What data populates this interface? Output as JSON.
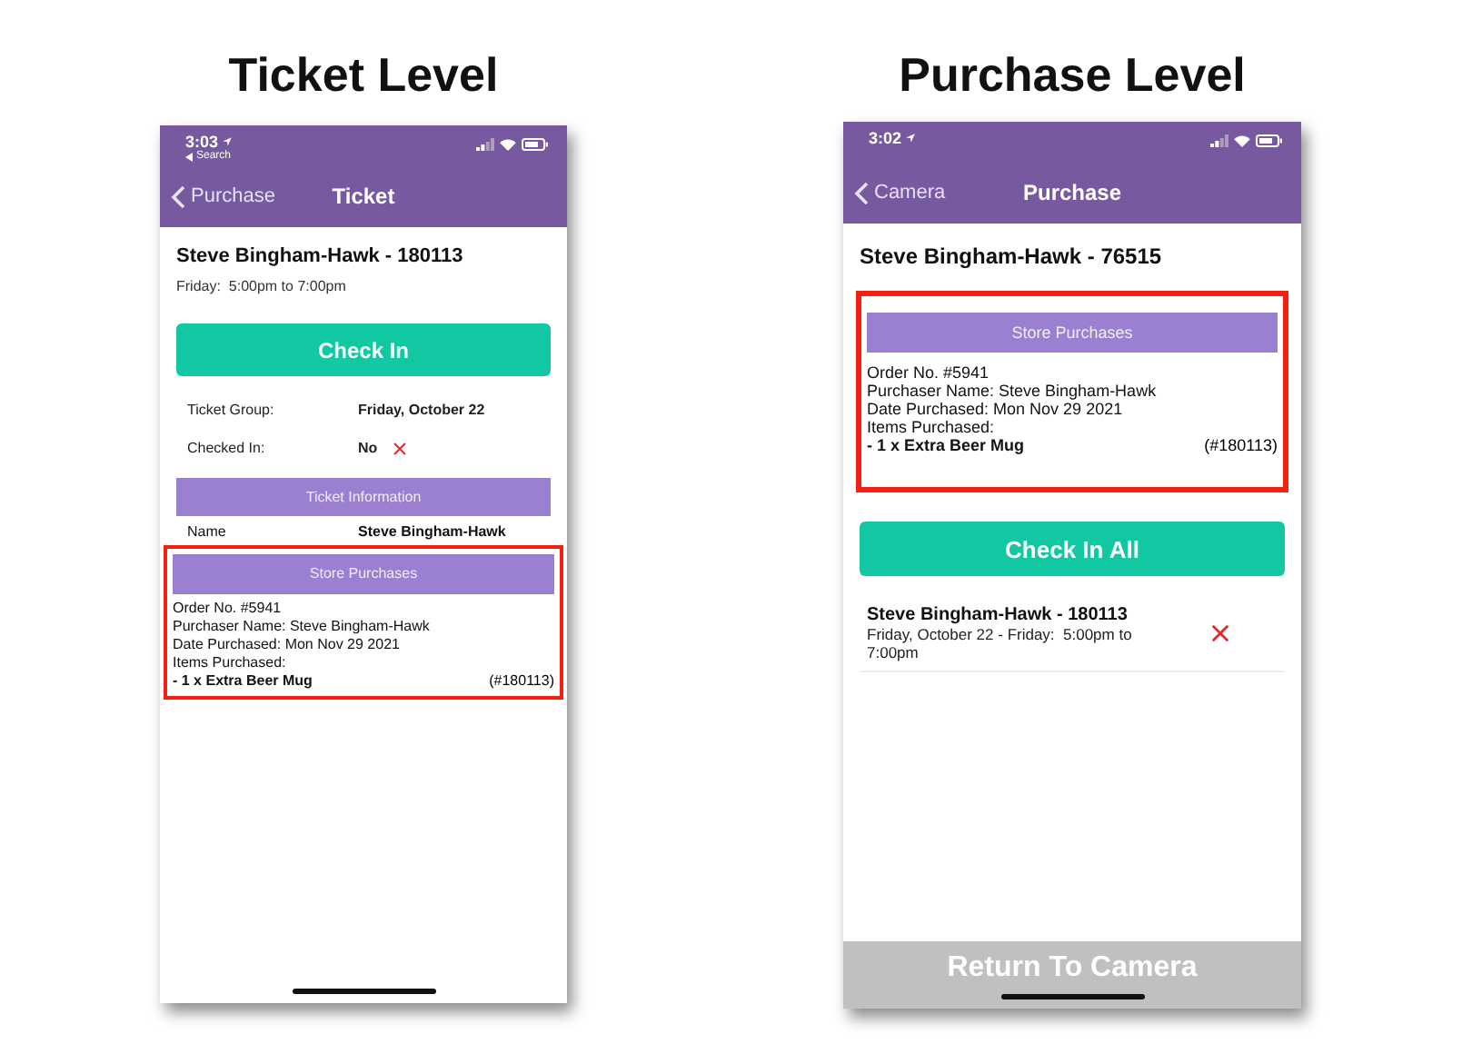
{
  "ticket_level": {
    "title": "Ticket Level",
    "status_bar": {
      "time": "3:03",
      "back_app": "Search"
    },
    "nav": {
      "back": "Purchase",
      "title": "Ticket"
    },
    "heading": "Steve Bingham-Hawk - 180113",
    "subheading": "Friday:  5:00pm to 7:00pm",
    "button": "Check In",
    "details": [
      {
        "label": "Ticket Group:",
        "value": "Friday, October 22"
      },
      {
        "label": "Checked In:",
        "value": "No",
        "checked_in": false
      }
    ],
    "info_header": "Ticket Information",
    "info_rows": [
      {
        "label": "Name",
        "value": "Steve Bingham-Hawk"
      }
    ],
    "purchases": {
      "header": "Store Purchases",
      "highlighted": true,
      "lines": [
        "Order No. #5941",
        "Purchaser Name: Steve Bingham-Hawk",
        "Date Purchased: Mon Nov 29 2021",
        "Items Purchased:"
      ],
      "item": {
        "text": "- 1 x Extra Beer Mug",
        "ref": "(#180113)"
      }
    }
  },
  "purchase_level": {
    "title": "Purchase Level",
    "status_bar": {
      "time": "3:02"
    },
    "nav": {
      "back": "Camera",
      "title": "Purchase"
    },
    "heading": "Steve Bingham-Hawk - 76515",
    "purchases": {
      "header": "Store Purchases",
      "highlighted": true,
      "lines": [
        "Order No. #5941",
        "Purchaser Name: Steve Bingham-Hawk",
        "Date Purchased: Mon Nov 29 2021",
        "Items Purchased:"
      ],
      "item": {
        "text": "- 1 x Extra Beer Mug",
        "ref": "(#180113)"
      }
    },
    "button": "Check In All",
    "tickets": [
      {
        "title": "Steve Bingham-Hawk - 180113",
        "subtitle": "Friday, October 22 - Friday:  5:00pm to 7:00pm",
        "checked_in": false
      }
    ],
    "footer_button": "Return To Camera"
  }
}
